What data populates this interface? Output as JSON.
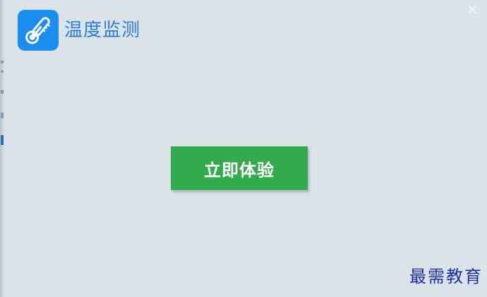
{
  "app": {
    "title": "温度监测",
    "logo_icon": "thermometer-icon",
    "close_icon": "close-icon",
    "close_glyph": "×"
  },
  "main": {
    "cta_label": "立即体验"
  },
  "watermark": {
    "text": "最需教育"
  },
  "colors": {
    "background": "#dbe2e8",
    "title": "#2a7fd0",
    "logo_tile": "#1a8ef0",
    "cta_button": "#31ab4c",
    "watermark": "#1b2fa6"
  }
}
